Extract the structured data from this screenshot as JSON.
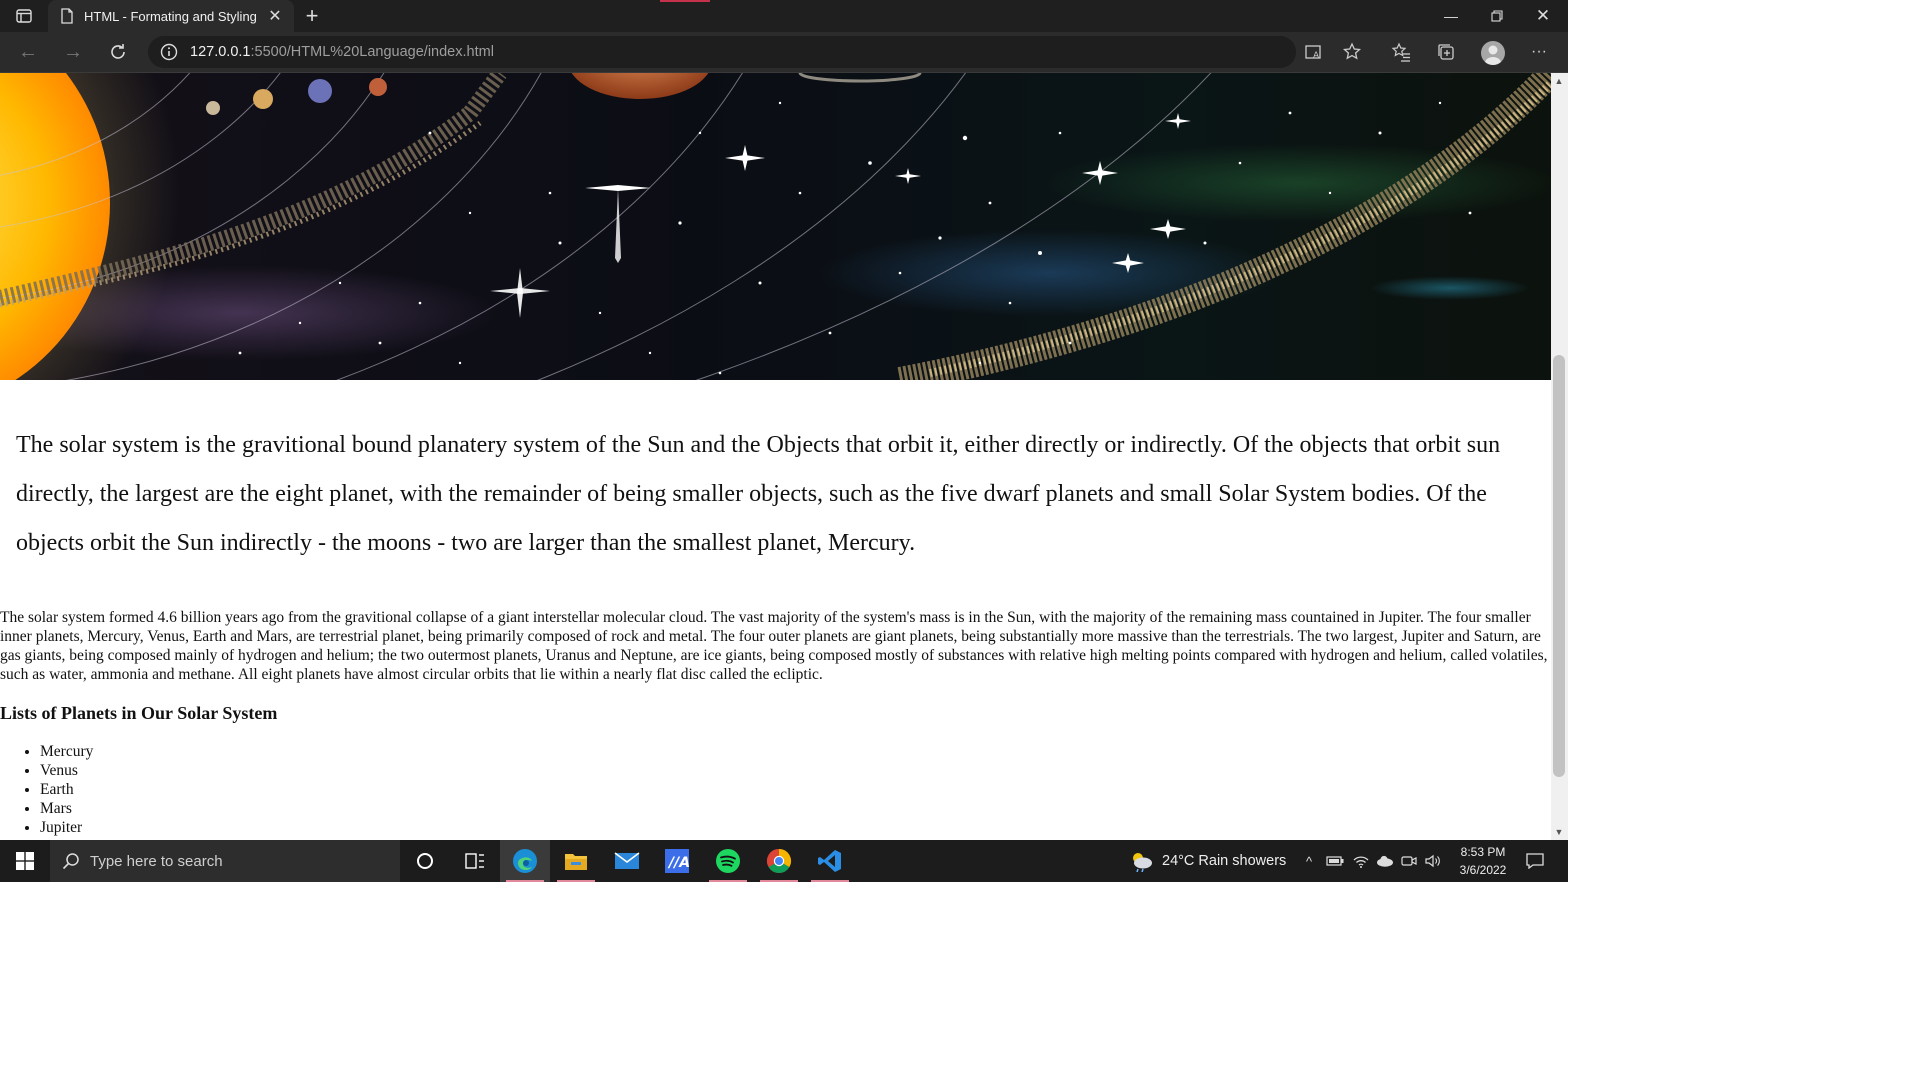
{
  "browser": {
    "tab_title": "HTML - Formating and Styling",
    "url_host": "127.0.0.1",
    "url_path": ":5500/HTML%20Language/index.html"
  },
  "page": {
    "lead_paragraph": "The solar system is the gravitional bound planatery system of the Sun and the Objects that orbit it, either directly or indirectly. Of the objects that orbit sun directly, the largest are the eight planet, with the remainder of being smaller objects, such as the five dwarf planets and small Solar System bodies. Of the objects orbit the Sun indirectly - the moons - two are larger than the smallest planet, Mercury.",
    "body_paragraph": "The solar system formed 4.6 billion years ago from the gravitional collapse of a giant interstellar molecular cloud. The vast majority of the system's mass is in the Sun, with the majority of the remaining mass countained in Jupiter. The four smaller inner planets, Mercury, Venus, Earth and Mars, are terrestrial planet, being primarily composed of rock and metal. The four outer planets are giant planets, being substantially more massive than the terrestrials. The two largest, Jupiter and Saturn, are gas giants, being composed mainly of hydrogen and helium; the two outermost planets, Uranus and Neptune, are ice giants, being composed mostly of substances with relative high melting points compared with hydrogen and helium, called volatiles, such as water, ammonia and methane. All eight planets have almost circular orbits that lie within a nearly flat disc called the ecliptic.",
    "list_heading": "Lists of Planets in Our Solar System",
    "planets": [
      "Mercury",
      "Venus",
      "Earth",
      "Mars",
      "Jupiter"
    ]
  },
  "taskbar": {
    "search_placeholder": "Type here to search",
    "weather": "24°C  Rain showers",
    "time": "8:53 PM",
    "date": "3/6/2022"
  }
}
